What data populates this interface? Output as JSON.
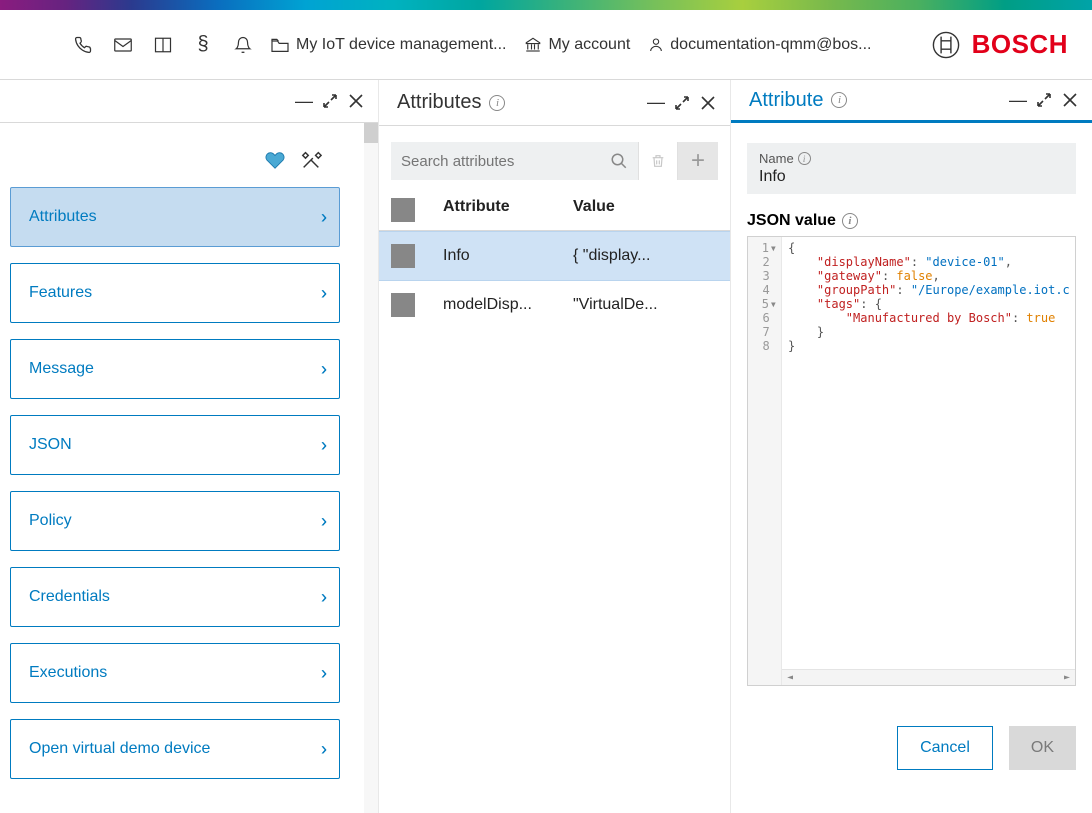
{
  "topbar": {
    "project_label": "My IoT device management...",
    "account_label": "My account",
    "user_label": "documentation-qmm@bos...",
    "brand": "BOSCH"
  },
  "left_panel": {
    "nav_items": [
      {
        "label": "Attributes",
        "selected": true
      },
      {
        "label": "Features",
        "selected": false
      },
      {
        "label": "Message",
        "selected": false
      },
      {
        "label": "JSON",
        "selected": false
      },
      {
        "label": "Policy",
        "selected": false
      },
      {
        "label": "Credentials",
        "selected": false
      },
      {
        "label": "Executions",
        "selected": false
      },
      {
        "label": "Open virtual demo device",
        "selected": false
      }
    ]
  },
  "mid_panel": {
    "title": "Attributes",
    "search_placeholder": "Search attributes",
    "columns": {
      "attr": "Attribute",
      "value": "Value"
    },
    "rows": [
      {
        "attr": "Info",
        "value": "{ \"display...",
        "selected": true
      },
      {
        "attr": "modelDisp...",
        "value": "\"VirtualDe...",
        "selected": false
      }
    ]
  },
  "right_panel": {
    "title": "Attribute",
    "name_label": "Name",
    "name_value": "Info",
    "json_label": "JSON value",
    "code": {
      "lines": [
        {
          "n": 1,
          "fold": true
        },
        {
          "n": 2
        },
        {
          "n": 3
        },
        {
          "n": 4
        },
        {
          "n": 5,
          "fold": true
        },
        {
          "n": 6
        },
        {
          "n": 7
        },
        {
          "n": 8
        }
      ],
      "keys": {
        "displayName": "\"displayName\"",
        "gateway": "\"gateway\"",
        "groupPath": "\"groupPath\"",
        "tags": "\"tags\"",
        "manufactured": "\"Manufactured by Bosch\""
      },
      "vals": {
        "device": "\"device-01\"",
        "false": "false",
        "group": "\"/Europe/example.iot.c",
        "true": "true"
      }
    },
    "buttons": {
      "cancel": "Cancel",
      "ok": "OK"
    }
  }
}
